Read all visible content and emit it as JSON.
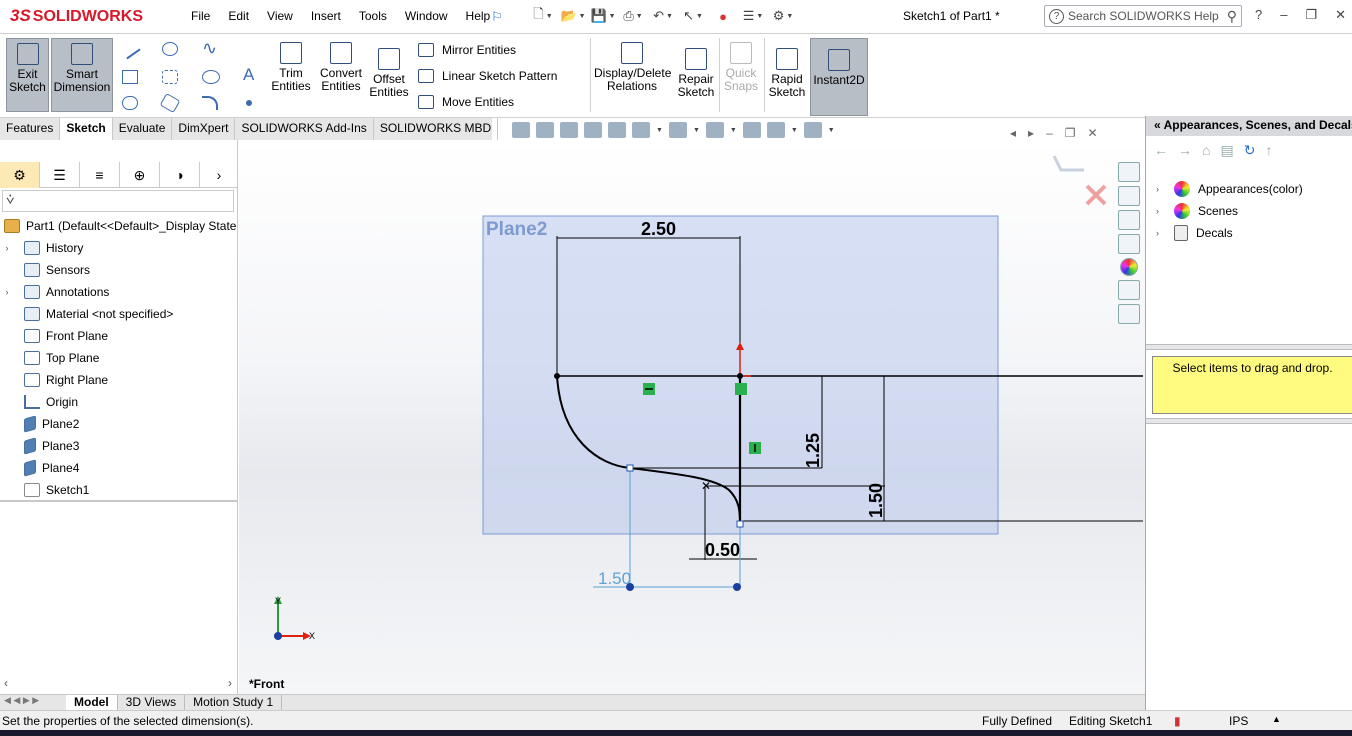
{
  "app": {
    "brand": "SOLIDWORKS",
    "doc_title": "Sketch1 of Part1 *"
  },
  "menu": [
    "File",
    "Edit",
    "View",
    "Insert",
    "Tools",
    "Window",
    "Help"
  ],
  "search": {
    "placeholder": "Search SOLIDWORKS Help"
  },
  "ribbon": {
    "exit_sketch": "Exit Sketch",
    "smart_dimension": "Smart Dimension",
    "trim": "Trim Entities",
    "convert": "Convert Entities",
    "offset": "Offset Entities",
    "mirror": "Mirror Entities",
    "linear_pattern": "Linear Sketch Pattern",
    "move": "Move Entities",
    "display_delete": "Display/Delete Relations",
    "repair": "Repair Sketch",
    "quick_snaps": "Quick Snaps",
    "rapid": "Rapid Sketch",
    "instant2d": "Instant2D"
  },
  "cm_tabs": [
    "Features",
    "Sketch",
    "Evaluate",
    "DimXpert",
    "SOLIDWORKS Add-Ins",
    "SOLIDWORKS MBD"
  ],
  "cm_active": "Sketch",
  "tree": {
    "root": "Part1  (Default<<Default>_Display State",
    "items": [
      "History",
      "Sensors",
      "Annotations",
      "Material <not specified>",
      "Front Plane",
      "Top Plane",
      "Right Plane",
      "Origin",
      "Plane2",
      "Plane3",
      "Plane4",
      "Sketch1"
    ]
  },
  "sketch": {
    "plane_label": "Plane2",
    "dims": [
      "2.50",
      "1.25",
      "1.50",
      "0.50",
      "1.50"
    ],
    "view_label": "*Front",
    "triad_x": "X",
    "triad_y": "Y"
  },
  "bottom_tabs": [
    "Model",
    "3D Views",
    "Motion Study 1"
  ],
  "bottom_active": "Model",
  "status": {
    "message": "Set the properties of the selected dimension(s).",
    "defined": "Fully Defined",
    "editing": "Editing Sketch1",
    "units": "IPS"
  },
  "task_pane": {
    "title": "Appearances, Scenes, and Decals",
    "items": [
      "Appearances(color)",
      "Scenes",
      "Decals"
    ],
    "hint": "Select items to drag and drop."
  }
}
